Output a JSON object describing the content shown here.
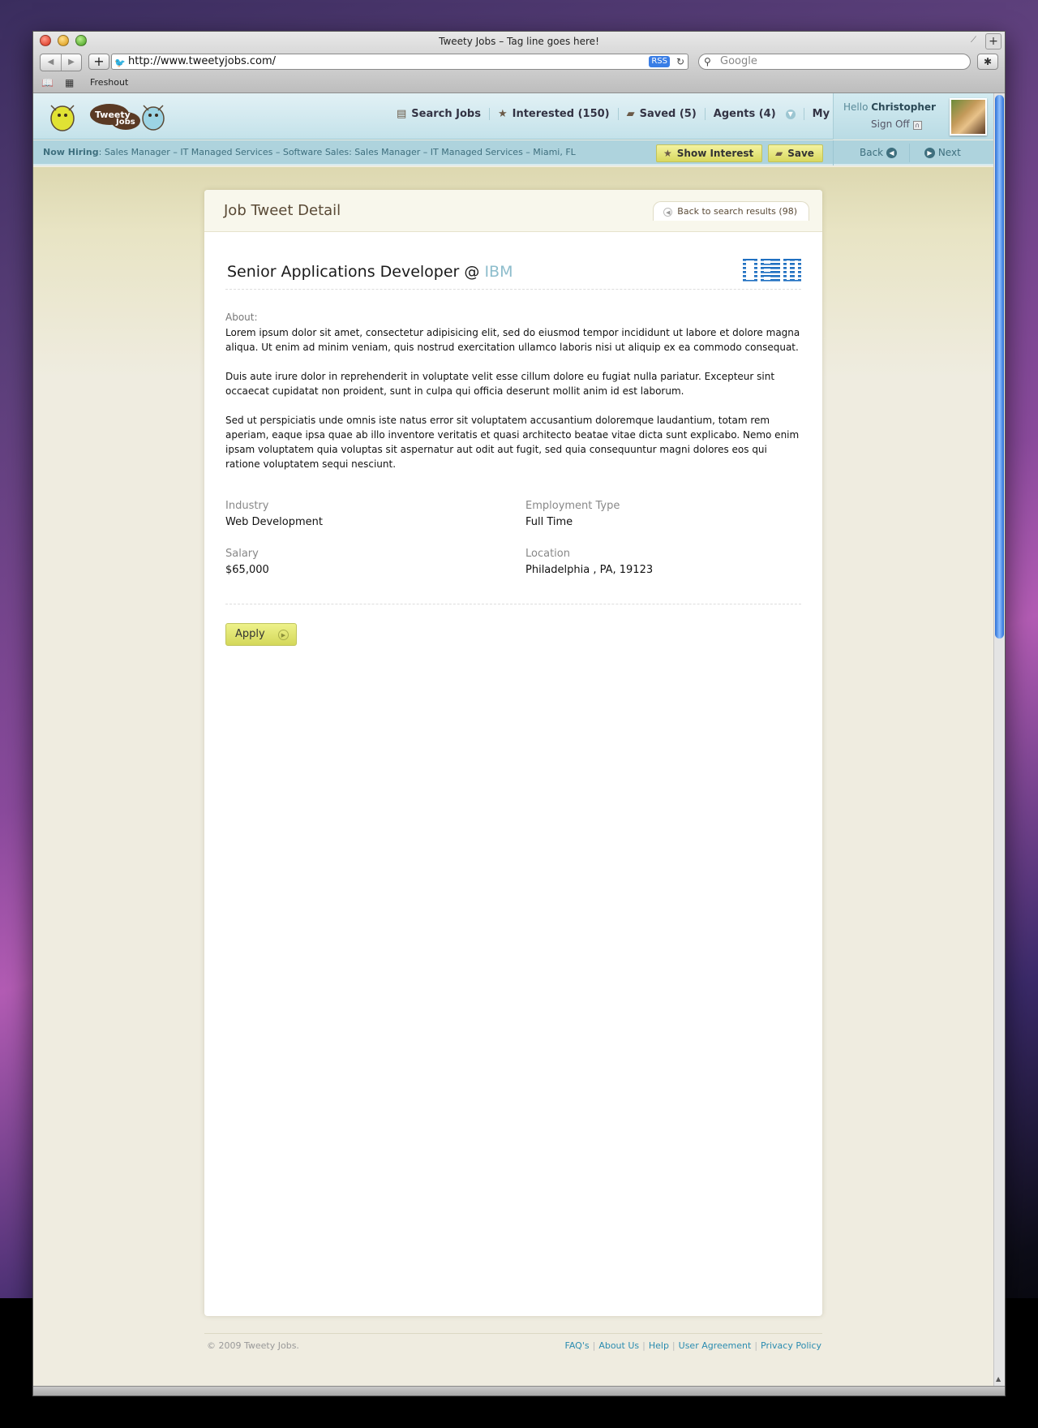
{
  "window": {
    "title": "Tweety Jobs – Tag line goes here!"
  },
  "browser": {
    "url": "http://www.tweetyjobs.com/",
    "rss_label": "RSS",
    "search_placeholder": "Google",
    "bookmarks": [
      "Freshout"
    ]
  },
  "brand": {
    "logo_text_1": "Tweety",
    "logo_text_2": "Jobs"
  },
  "nav": {
    "items": [
      {
        "label": "Search Jobs",
        "icon": "newspaper-icon"
      },
      {
        "label": "Interested (150)",
        "icon": "star-icon"
      },
      {
        "label": "Saved (5)",
        "icon": "folder-icon"
      },
      {
        "label": "Agents (4)",
        "icon": "chevron-down-icon"
      },
      {
        "label": "My Stuff",
        "icon": "chevron-down-icon"
      }
    ]
  },
  "user": {
    "greeting": "Hello",
    "name": "Christopher",
    "sign_off": "Sign Off"
  },
  "subbar": {
    "now_hiring_label": "Now Hiring",
    "now_hiring_text": ": Sales Manager – IT Managed Services – Software Sales: Sales Manager – IT Managed Services – Miami, FL",
    "show_interest": "Show Interest",
    "save": "Save",
    "back": "Back",
    "next": "Next"
  },
  "card": {
    "title": "Job Tweet Detail",
    "back_to_results": "Back to search results (98)",
    "job_title": "Senior Applications Developer @",
    "company": "IBM",
    "about_label": "About:",
    "about": [
      "Lorem ipsum dolor sit amet, consectetur adipisicing elit, sed do eiusmod tempor incididunt ut labore et dolore magna aliqua. Ut enim ad minim veniam, quis nostrud exercitation ullamco laboris nisi ut aliquip ex ea commodo consequat.",
      "Duis aute irure dolor in reprehenderit in voluptate velit esse cillum dolore eu fugiat nulla pariatur. Excepteur sint occaecat cupidatat non proident, sunt in culpa qui officia deserunt mollit anim id est laborum.",
      "Sed ut perspiciatis unde omnis iste natus error sit voluptatem accusantium doloremque laudantium, totam rem aperiam, eaque ipsa quae ab illo inventore veritatis et quasi architecto beatae vitae dicta sunt explicabo. Nemo enim ipsam voluptatem quia voluptas sit aspernatur aut odit aut fugit, sed quia consequuntur magni dolores eos qui ratione voluptatem sequi nesciunt."
    ],
    "fields": {
      "industry_label": "Industry",
      "industry": "Web Development",
      "employment_label": "Employment Type",
      "employment": "Full Time",
      "salary_label": "Salary",
      "salary": "$65,000",
      "location_label": "Location",
      "location": "Philadelphia , PA, 19123"
    },
    "apply": "Apply"
  },
  "footer": {
    "copyright": "© 2009 Tweety Jobs.",
    "links": [
      "FAQ's",
      "About Us",
      "Help",
      "User Agreement",
      "Privacy Policy"
    ]
  },
  "colors": {
    "accent_blue": "#2b8cb0",
    "header_blue": "#c4e2ea",
    "button_yellow": "#e4e878",
    "brown": "#5a4a36"
  }
}
